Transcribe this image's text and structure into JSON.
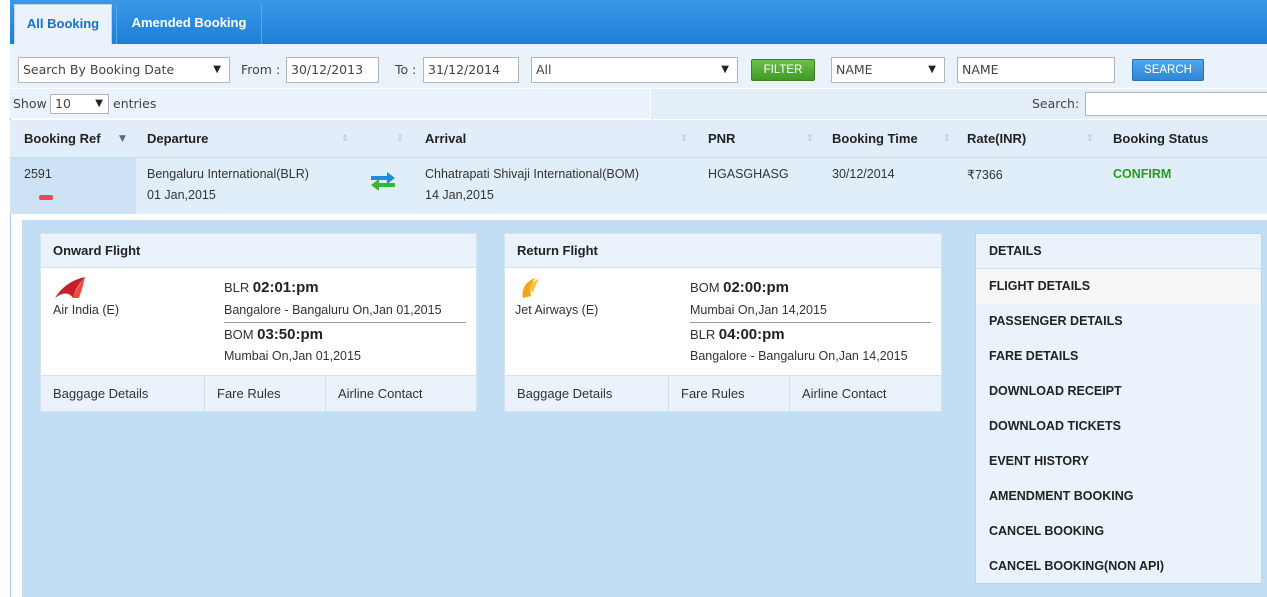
{
  "tabs": [
    {
      "label": "All Booking"
    },
    {
      "label": "Amended Booking"
    }
  ],
  "filters": {
    "search_by": "Search By Booking Date",
    "from_label": "From :",
    "from_value": "30/12/2013",
    "to_label": "To :",
    "to_value": "31/12/2014",
    "status_select": "All",
    "filter_button": "FILTER",
    "name_select": "NAME",
    "name_input": "NAME",
    "search_button": "SEARCH"
  },
  "table_controls": {
    "show_label": "Show",
    "entries_value": "10",
    "entries_label": "entries",
    "search_label": "Search:"
  },
  "columns": [
    "Booking Ref",
    "Departure",
    "Arrival",
    "PNR",
    "Booking Time",
    "Rate(INR)",
    "Booking Status"
  ],
  "booking": {
    "ref": "2591",
    "departure_airport": "Bengaluru International(BLR)",
    "departure_date": "01 Jan,2015",
    "arrival_airport": "Chhatrapati Shivaji International(BOM)",
    "arrival_date": "14 Jan,2015",
    "pnr": "HGASGHASG",
    "booking_time": "30/12/2014",
    "rate": "₹7366",
    "status": "CONFIRM"
  },
  "onward": {
    "title": "Onward Flight",
    "airline": "Air India (E)",
    "dep_code": "BLR",
    "dep_time": "02:01:pm",
    "dep_place": "Bangalore - Bangaluru On,Jan 01,2015",
    "arr_code": "BOM",
    "arr_time": "03:50:pm",
    "arr_place": "Mumbai On,Jan 01,2015",
    "footer": [
      "Baggage Details",
      "Fare Rules",
      "Airline Contact"
    ]
  },
  "return": {
    "title": "Return Flight",
    "airline": "Jet Airways (E)",
    "dep_code": "BOM",
    "dep_time": "02:00:pm",
    "dep_place": "Mumbai On,Jan 14,2015",
    "arr_code": "BLR",
    "arr_time": "04:00:pm",
    "arr_place": "Bangalore - Bangaluru On,Jan 14,2015",
    "footer": [
      "Baggage Details",
      "Fare Rules",
      "Airline Contact"
    ]
  },
  "menu": {
    "header": "DETAILS",
    "items": [
      "FLIGHT DETAILS",
      "PASSENGER DETAILS",
      "FARE DETAILS",
      "DOWNLOAD RECEIPT",
      "DOWNLOAD TICKETS",
      "EVENT HISTORY",
      "AMENDMENT BOOKING",
      "CANCEL BOOKING",
      "CANCEL BOOKING(NON API)"
    ]
  },
  "colors": {
    "tab_bar": "#2a8be0",
    "confirm_status": "#2a9a1a",
    "expanded_bg": "#c2def4",
    "remove_icon": "#e74a55"
  },
  "icons": {
    "row_remove": "minus-icon",
    "route": "swap-arrows-icon",
    "onward_logo": "air-india-logo-icon",
    "return_logo": "jet-airways-logo-icon",
    "sort": "sort-arrows-icon"
  }
}
